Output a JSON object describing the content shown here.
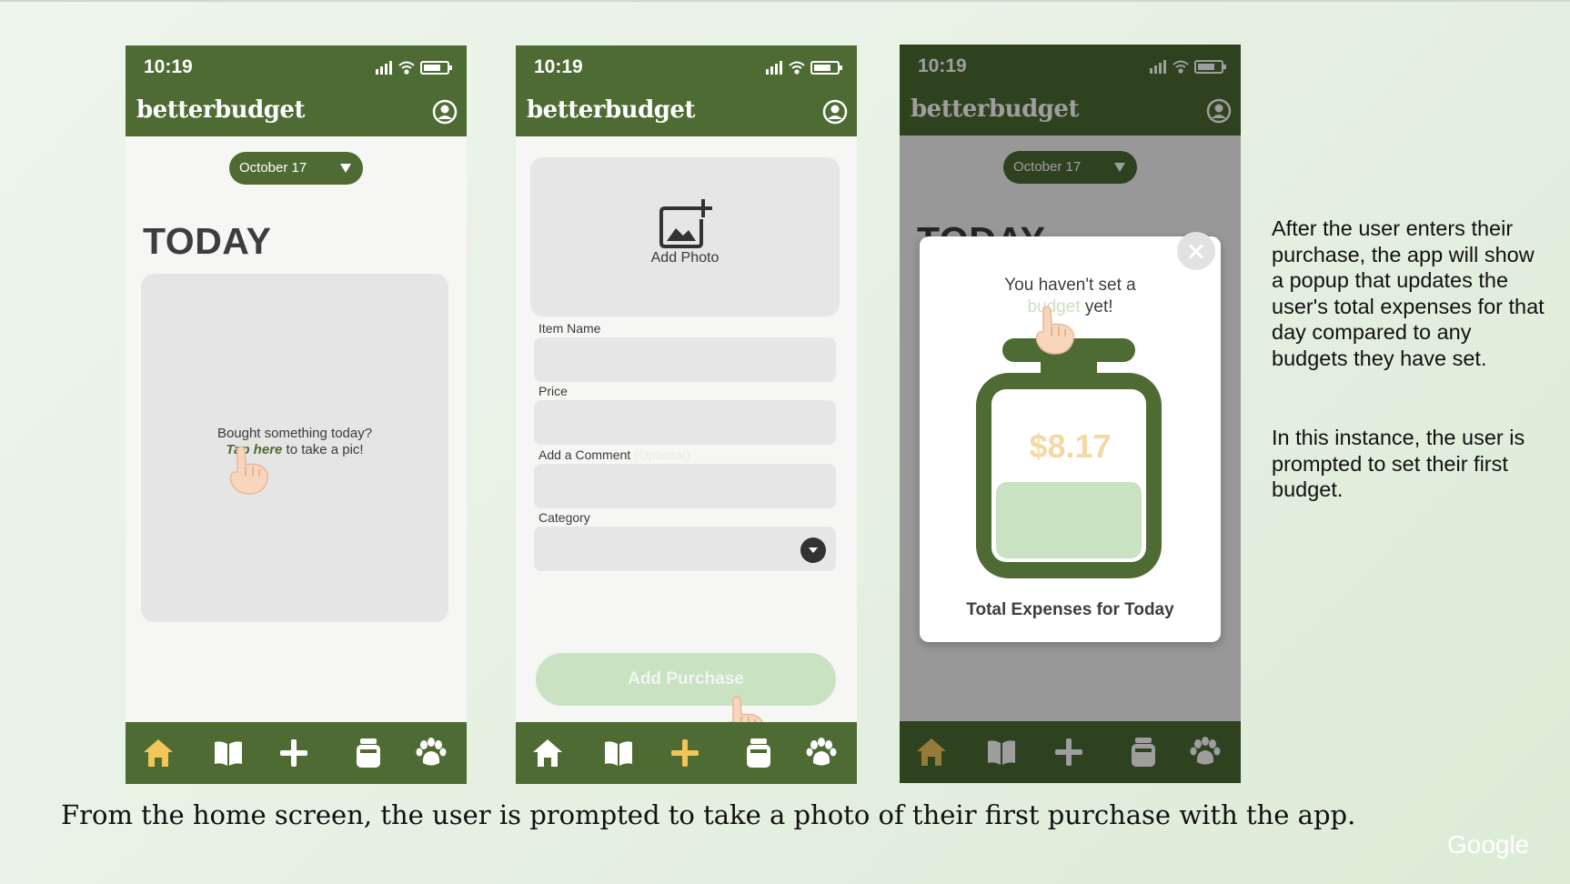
{
  "colors": {
    "brand_green": "#4d6b33",
    "light_green": "#c8e2c2",
    "amount_yellow": "#f3d9a3",
    "nav_accent": "#f3c65a"
  },
  "phones": {
    "home": {
      "time": "10:19",
      "logo": "betterbudget",
      "date_selector": "October 17",
      "title": "TODAY",
      "prompt_line1": "Bought something today?",
      "prompt_tap": "Tap here",
      "prompt_rest": " to take a pic!",
      "nav_active": "home"
    },
    "form": {
      "time": "10:19",
      "logo": "betterbudget",
      "add_photo_label": "Add Photo",
      "fields": {
        "item_name": "Item Name",
        "price": "Price",
        "comment": "Add a Comment",
        "comment_optional": "(Optional)",
        "category": "Category"
      },
      "submit_label": "Add Purchase",
      "nav_active": "add"
    },
    "popup": {
      "time": "10:19",
      "logo": "betterbudget",
      "date_selector": "October 17",
      "background_title": "TODAY",
      "message_line1": "You haven't set a",
      "message_highlight": "budget",
      "message_end": " yet!",
      "amount": "$8.17",
      "caption": "Total Expenses for Today"
    }
  },
  "nav_icons": [
    "home-icon",
    "book-icon",
    "plus-icon",
    "jar-icon",
    "paw-icon"
  ],
  "side_text": {
    "paragraph1": "After the user enters their purchase, the app will show a popup that updates the user's total expenses for that day compared to any budgets they have set.",
    "paragraph2": "In this instance, the user is prompted to set their first budget."
  },
  "caption": "From the home screen, the user is prompted to take a photo of their first purchase with the app.",
  "footer_logo": "Google"
}
